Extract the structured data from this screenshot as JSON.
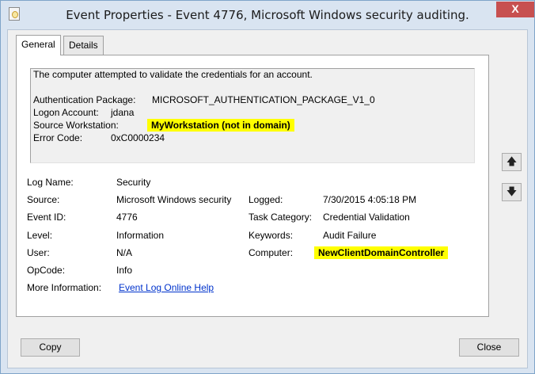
{
  "window": {
    "title": "Event Properties - Event 4776, Microsoft Windows security auditing.",
    "close_glyph": "X"
  },
  "tabs": [
    {
      "label": "General",
      "selected": true
    },
    {
      "label": "Details",
      "selected": false
    }
  ],
  "description": {
    "intro": "The computer attempted to validate the credentials for an account.",
    "auth_package_label": "Authentication Package:",
    "auth_package_value": "MICROSOFT_AUTHENTICATION_PACKAGE_V1_0",
    "logon_account_label": "Logon Account:",
    "logon_account_value": "jdana",
    "source_workstation_label": "Source Workstation:",
    "source_workstation_value": "MyWorkstation (not in domain)",
    "error_code_label": "Error Code:",
    "error_code_value": "0xC0000234"
  },
  "fields": {
    "log_name": {
      "label": "Log Name:",
      "value": "Security"
    },
    "source": {
      "label": "Source:",
      "value": "Microsoft Windows security"
    },
    "logged": {
      "label": "Logged:",
      "value": "7/30/2015 4:05:18 PM"
    },
    "event_id": {
      "label": "Event ID:",
      "value": "4776"
    },
    "task_category": {
      "label": "Task Category:",
      "value": "Credential Validation"
    },
    "level": {
      "label": "Level:",
      "value": "Information"
    },
    "keywords": {
      "label": "Keywords:",
      "value": "Audit Failure"
    },
    "user": {
      "label": "User:",
      "value": "N/A"
    },
    "computer": {
      "label": "Computer:",
      "value": "NewClientDomainController"
    },
    "opcode": {
      "label": "OpCode:",
      "value": "Info"
    },
    "more_info": {
      "label": "More Information:",
      "link": "Event Log Online Help"
    }
  },
  "side_buttons": {
    "up_glyph": "🡅",
    "down_glyph": "🡇"
  },
  "buttons": {
    "copy": "Copy",
    "close": "Close"
  },
  "colors": {
    "highlight": "#ffff00",
    "link": "#0033cc",
    "close_button": "#c75050"
  }
}
